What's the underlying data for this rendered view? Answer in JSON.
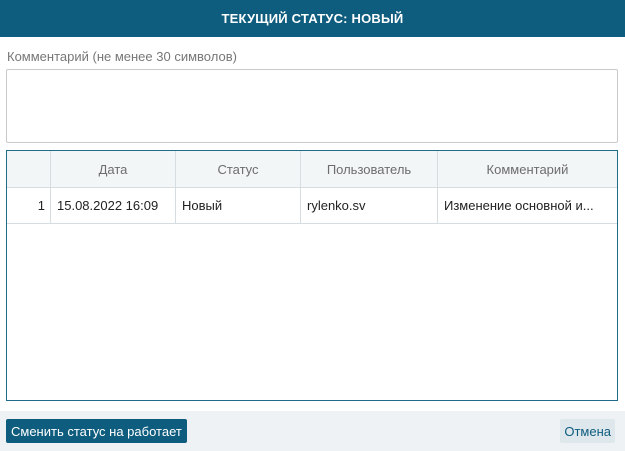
{
  "dialog": {
    "title": "ТЕКУЩИЙ СТАТУС: НОВЫЙ"
  },
  "comment": {
    "label": "Комментарий (не менее 30 символов)",
    "value": "",
    "placeholder": ""
  },
  "grid": {
    "columns": [
      "",
      "Дата",
      "Статус",
      "Пользователь",
      "Комментарий"
    ],
    "rows": [
      {
        "num": "1",
        "date": "15.08.2022 16:09",
        "status": "Новый",
        "user": "rylenko.sv",
        "comment": "Изменение основной и..."
      }
    ]
  },
  "footer": {
    "change_status_label": "Сменить статус на работает",
    "cancel_label": "Отмена"
  },
  "colors": {
    "accent": "#0e5c7e",
    "border": "#1f6b8a",
    "header_bg": "#f3f6f7"
  }
}
